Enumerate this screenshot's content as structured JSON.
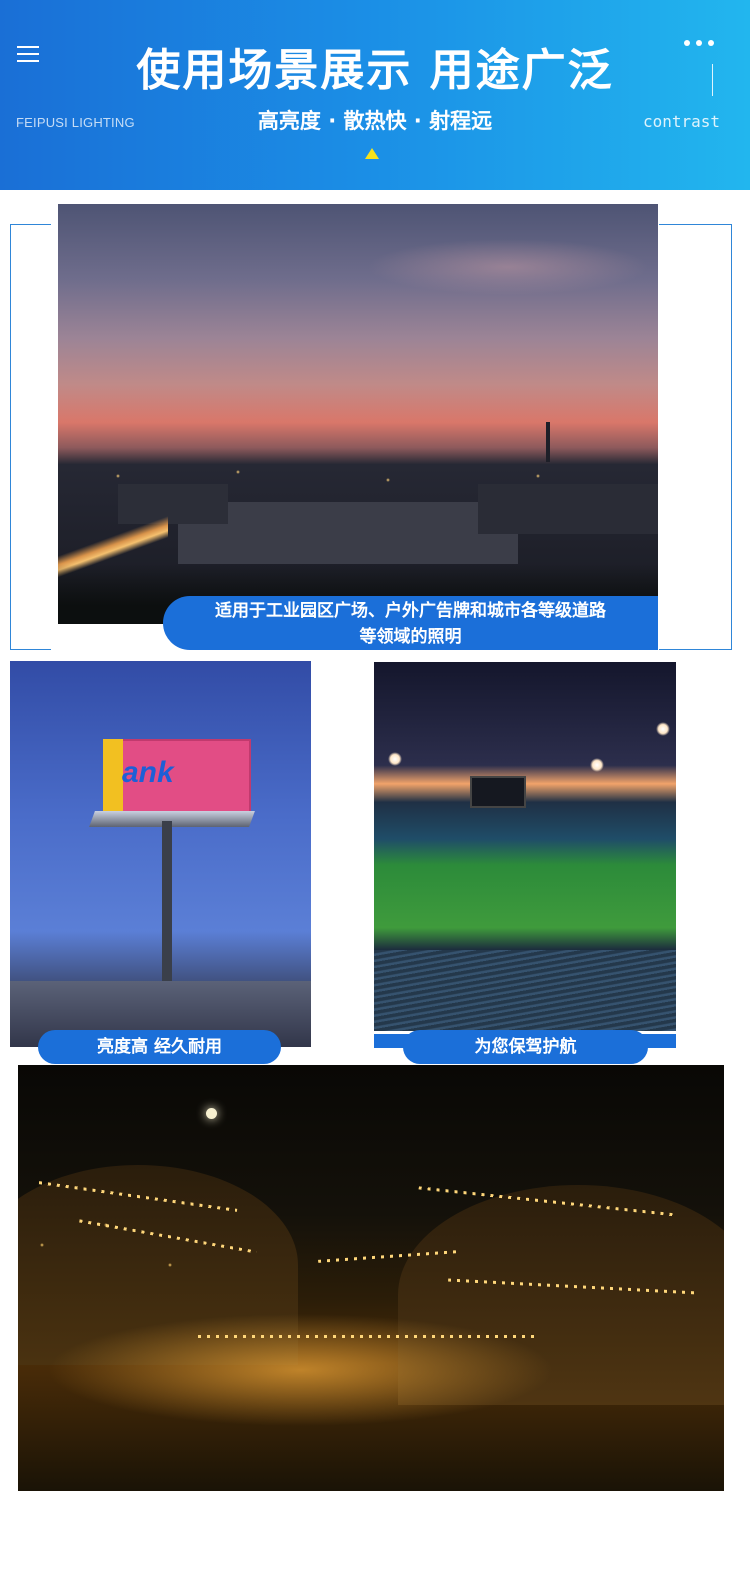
{
  "header": {
    "title": "使用场景展示 用途广泛",
    "subtitle": "高亮度 · 散热快 · 射程远",
    "brand": "FEIPUSI LIGHTING",
    "contrast_label": "contrast",
    "menu_icon": "hamburger-menu-icon",
    "more_icon": "more-dots-icon",
    "accent_color": "#f6e21a",
    "background_colors": [
      "#1a6fd6",
      "#22b6ee"
    ]
  },
  "scenes": {
    "industrial_caption_line1": "适用于工业园区广场、户外广告牌和城市各等级道路",
    "industrial_caption_line2": "等领域的照明",
    "billboard_caption": "亮度高 经久耐用",
    "billboard_text": "ank",
    "stadium_caption": "为您保驾护航"
  },
  "caption_color": "#1b6fd9"
}
